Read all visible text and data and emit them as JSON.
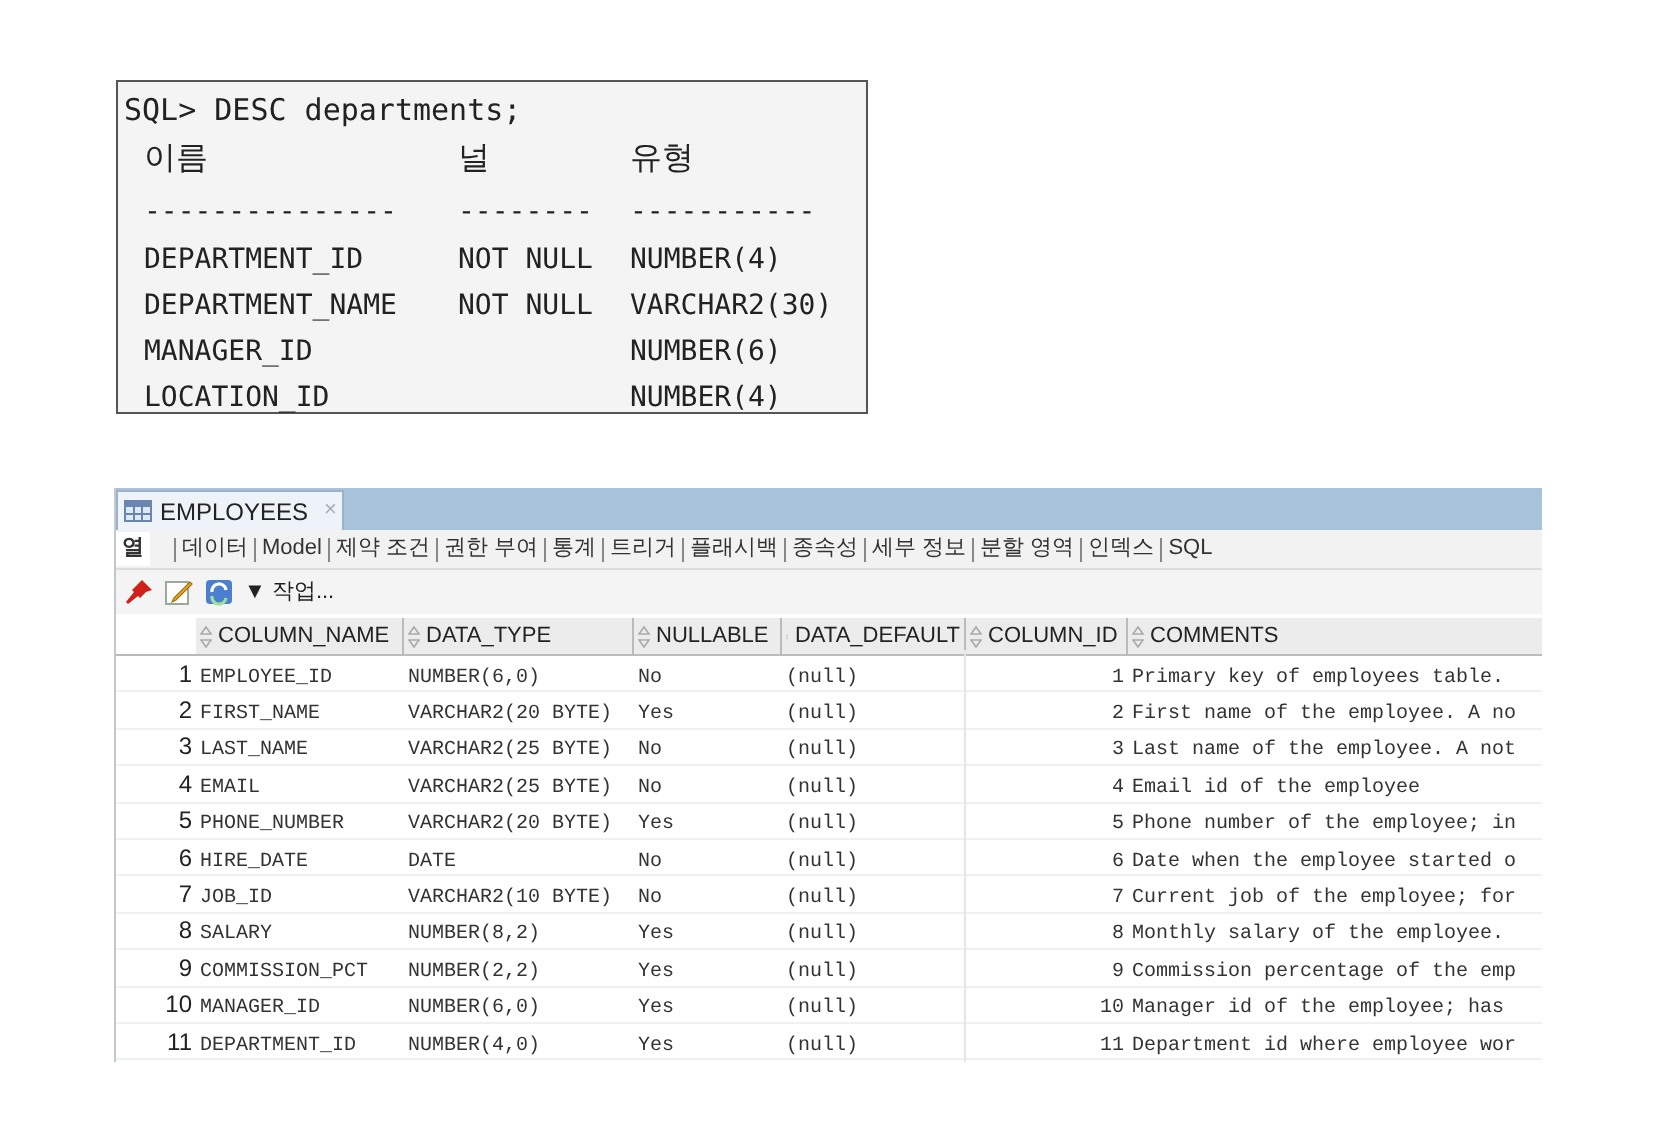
{
  "console": {
    "command": "SQL> DESC departments;",
    "headers": [
      "이름",
      "널",
      "유형"
    ],
    "dashes": [
      "---------------",
      "--------",
      "-----------"
    ],
    "rows": [
      {
        "name": "DEPARTMENT_ID",
        "null": "NOT NULL",
        "type": "NUMBER(4)"
      },
      {
        "name": "DEPARTMENT_NAME",
        "null": "NOT NULL",
        "type": "VARCHAR2(30)"
      },
      {
        "name": "MANAGER_ID",
        "null": "",
        "type": "NUMBER(6)"
      },
      {
        "name": "LOCATION_ID",
        "null": "",
        "type": "NUMBER(4)"
      }
    ]
  },
  "editor": {
    "tab": {
      "title": "EMPLOYEES",
      "close": "×"
    },
    "subtabs": [
      {
        "label": "열",
        "selected": true
      },
      {
        "label": "데이터",
        "selected": false
      },
      {
        "label": "Model",
        "selected": false
      },
      {
        "label": "제약 조건",
        "selected": false
      },
      {
        "label": "권한 부여",
        "selected": false
      },
      {
        "label": "통계",
        "selected": false
      },
      {
        "label": "트리거",
        "selected": false
      },
      {
        "label": "플래시백",
        "selected": false
      },
      {
        "label": "종속성",
        "selected": false
      },
      {
        "label": "세부 정보",
        "selected": false
      },
      {
        "label": "분할 영역",
        "selected": false
      },
      {
        "label": "인덱스",
        "selected": false
      },
      {
        "label": "SQL",
        "selected": false
      }
    ],
    "actions_menu": "▼ 작업...",
    "table": {
      "columns": [
        "",
        "COLUMN_NAME",
        "DATA_TYPE",
        "NULLABLE",
        "DATA_DEFAULT",
        "COLUMN_ID",
        "COMMENTS"
      ],
      "rows": [
        [
          "1",
          "EMPLOYEE_ID",
          "NUMBER(6,0)",
          "No",
          "(null)",
          "1",
          "Primary key of employees table."
        ],
        [
          "2",
          "FIRST_NAME",
          "VARCHAR2(20 BYTE)",
          "Yes",
          "(null)",
          "2",
          "First name of the employee. A no"
        ],
        [
          "3",
          "LAST_NAME",
          "VARCHAR2(25 BYTE)",
          "No",
          "(null)",
          "3",
          "Last name of the employee. A not"
        ],
        [
          "4",
          "EMAIL",
          "VARCHAR2(25 BYTE)",
          "No",
          "(null)",
          "4",
          "Email id of the employee"
        ],
        [
          "5",
          "PHONE_NUMBER",
          "VARCHAR2(20 BYTE)",
          "Yes",
          "(null)",
          "5",
          "Phone number of the employee; in"
        ],
        [
          "6",
          "HIRE_DATE",
          "DATE",
          "No",
          "(null)",
          "6",
          "Date when the employee started o"
        ],
        [
          "7",
          "JOB_ID",
          "VARCHAR2(10 BYTE)",
          "No",
          "(null)",
          "7",
          "Current job of the employee; for"
        ],
        [
          "8",
          "SALARY",
          "NUMBER(8,2)",
          "Yes",
          "(null)",
          "8",
          "Monthly salary of the employee."
        ],
        [
          "9",
          "COMMISSION_PCT",
          "NUMBER(2,2)",
          "Yes",
          "(null)",
          "9",
          "Commission percentage of the emp"
        ],
        [
          "10",
          "MANAGER_ID",
          "NUMBER(6,0)",
          "Yes",
          "(null)",
          "10",
          "Manager id of the employee; has"
        ],
        [
          "11",
          "DEPARTMENT_ID",
          "NUMBER(4,0)",
          "Yes",
          "(null)",
          "11",
          "Department id where employee wor"
        ]
      ]
    }
  }
}
